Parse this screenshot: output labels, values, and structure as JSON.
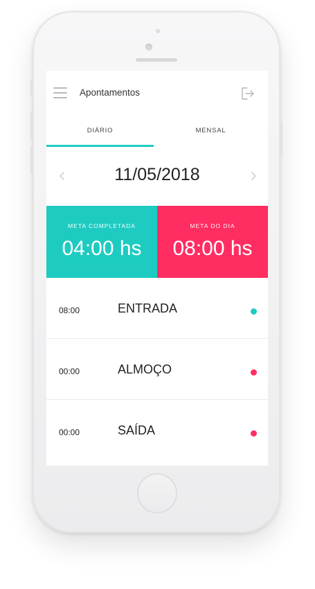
{
  "header": {
    "title": "Apontamentos",
    "menu_icon": "hamburger-menu-icon",
    "logout_icon": "logout-icon"
  },
  "tabs": [
    {
      "label": "DIÁRIO",
      "active": true
    },
    {
      "label": "MENSAL",
      "active": false
    }
  ],
  "date_nav": {
    "date": "11/05/2018",
    "prev_icon": "chevron-left-icon",
    "next_icon": "chevron-right-icon"
  },
  "cards": {
    "completed": {
      "label": "META COMPLETADA",
      "value": "04:00 hs",
      "color": "#1ecbc1"
    },
    "goal": {
      "label": "META DO DIA",
      "value": "08:00 hs",
      "color": "#ff2d62"
    }
  },
  "entries": [
    {
      "time": "08:00",
      "label": "ENTRADA",
      "status_color": "#1ecbc1"
    },
    {
      "time": "00:00",
      "label": "ALMOÇO",
      "status_color": "#ff2d62"
    },
    {
      "time": "00:00",
      "label": "SAÍDA",
      "status_color": "#ff2d62"
    }
  ],
  "colors": {
    "accent": "#1ecbc1",
    "alert": "#ff2d62"
  }
}
